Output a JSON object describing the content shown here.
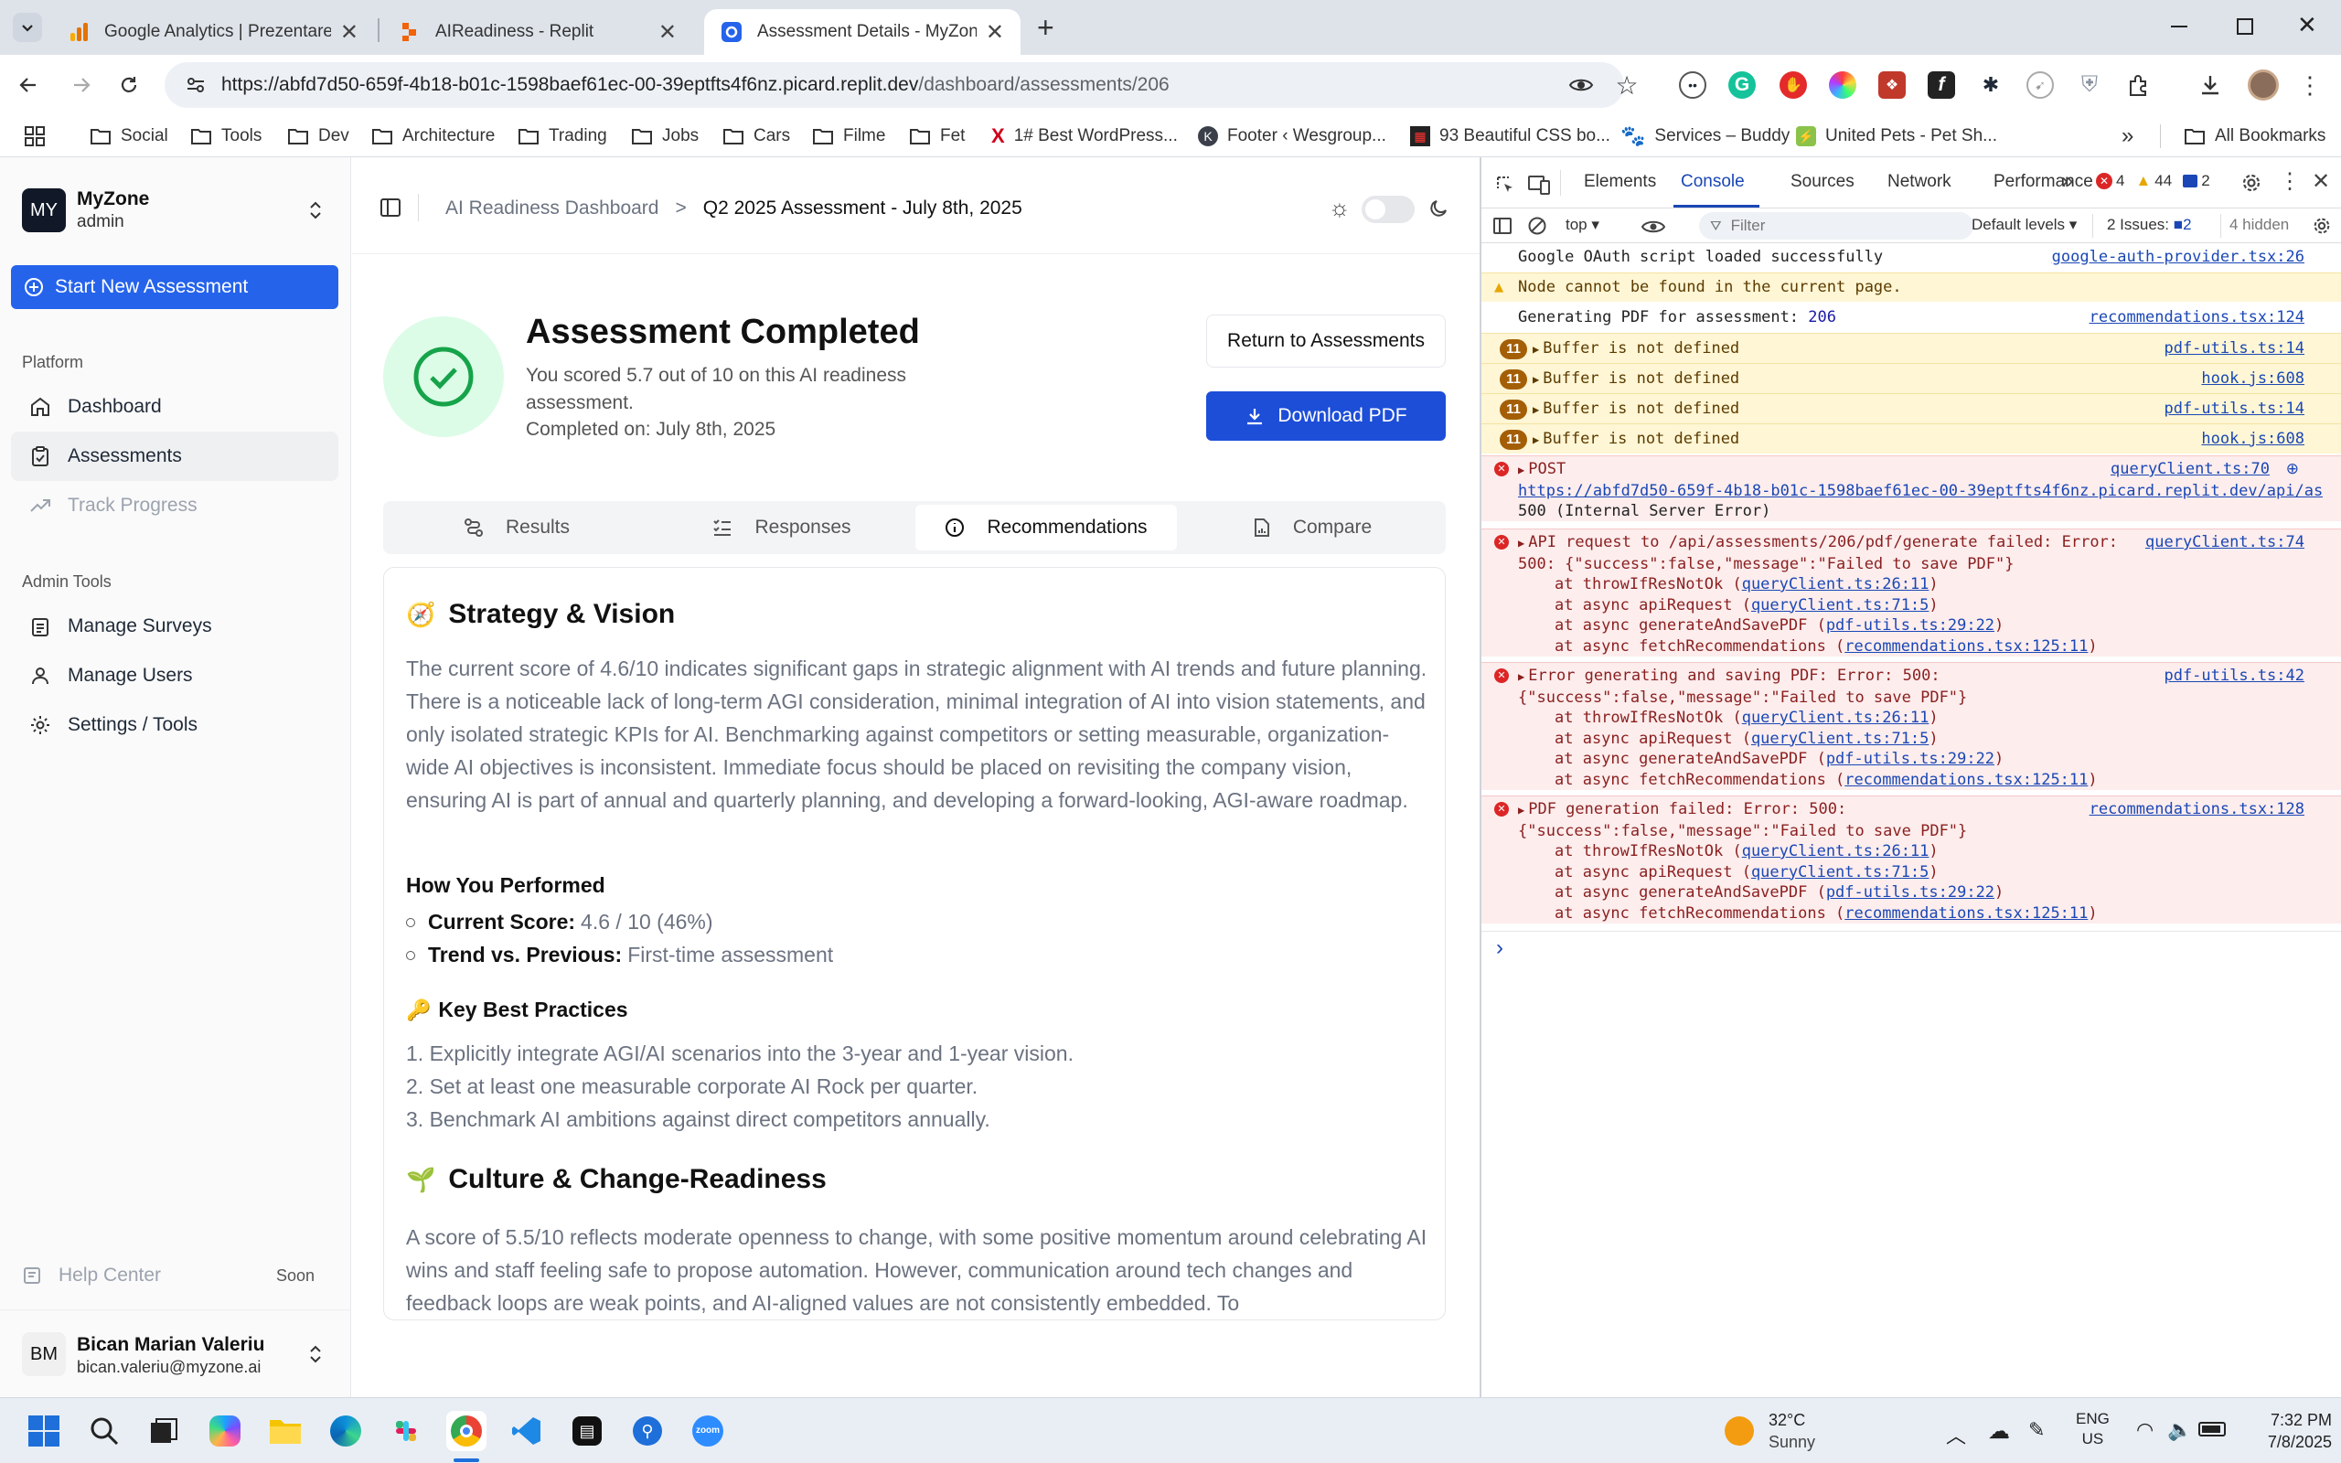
{
  "browser": {
    "tabs": [
      {
        "title": "Google Analytics | Prezentare g"
      },
      {
        "title": "AIReadiness - Replit"
      },
      {
        "title": "Assessment Details - MyZone A"
      }
    ],
    "url_host": "https://abfd7d50-659f-4b18-b01c-1598baef61ec-00-39eptfts4f6nz.picard.replit.dev",
    "url_path": "/dashboard/assessments/206",
    "bookmarks": [
      "Social",
      "Tools",
      "Dev",
      "Architecture",
      "Trading",
      "Jobs",
      "Cars",
      "Filme",
      "Fet",
      "1# Best WordPress...",
      "Footer ‹ Wesgroup...",
      "93 Beautiful CSS bo...",
      "Services – Buddy",
      "United Pets - Pet Sh..."
    ],
    "all_bookmarks": "All Bookmarks",
    "more_bookmarks": "»"
  },
  "sidebar": {
    "logo_initials": "MY",
    "org_name": "MyZone",
    "org_role": "admin",
    "new_assessment": "Start New Assessment",
    "platform_heading": "Platform",
    "platform_items": [
      "Dashboard",
      "Assessments",
      "Track Progress"
    ],
    "admin_heading": "Admin Tools",
    "admin_items": [
      "Manage Surveys",
      "Manage Users",
      "Settings / Tools"
    ],
    "help_center": "Help Center",
    "help_badge": "Soon",
    "user_initials": "BM",
    "user_name": "Bican Marian Valeriu",
    "user_email": "bican.valeriu@myzone.ai"
  },
  "main": {
    "breadcrumb_root": "AI Readiness Dashboard",
    "breadcrumb_sep": ">",
    "breadcrumb_current": "Q2 2025 Assessment - July 8th, 2025",
    "status_title": "Assessment Completed",
    "score_text": "You scored 5.7 out of 10 on this AI readiness assessment.",
    "completed_text": "Completed on: July 8th, 2025",
    "return_button": "Return to Assessments",
    "download_button": "Download PDF",
    "tabs": [
      "Results",
      "Responses",
      "Recommendations",
      "Compare"
    ],
    "section1": {
      "emoji": "🧭",
      "title": "Strategy & Vision",
      "body": "The current score of 4.6/10 indicates significant gaps in strategic alignment with AI trends and future planning. There is a noticeable lack of long-term AGI consideration, minimal integration of AI into vision statements, and only isolated strategic KPIs for AI. Benchmarking against competitors or setting measurable, organization-wide AI objectives is inconsistent. Immediate focus should be placed on revisiting the company vision, ensuring AI is part of annual and quarterly planning, and developing a forward-looking, AGI-aware roadmap.",
      "perf_heading": "How You Performed",
      "current_score_label": "Current Score:",
      "current_score_value": "4.6 / 10 (46%)",
      "trend_label": "Trend vs. Previous:",
      "trend_value": "First-time assessment",
      "practices_emoji": "🔑",
      "practices_heading": "Key Best Practices",
      "practices": [
        "1. Explicitly integrate AGI/AI scenarios into the 3-year and 1-year vision.",
        "2. Set at least one measurable corporate AI Rock per quarter.",
        "3. Benchmark AI ambitions against direct competitors annually."
      ]
    },
    "section2": {
      "emoji": "🌱",
      "title": "Culture & Change-Readiness",
      "body": "A score of 5.5/10 reflects moderate openness to change, with some positive momentum around celebrating AI wins and staff feeling safe to propose automation. However, communication around tech changes and feedback loops are weak points, and AI-aligned values are not consistently embedded. To"
    }
  },
  "devtools": {
    "tabs": [
      "Elements",
      "Console",
      "Sources",
      "Network",
      "Performance"
    ],
    "error_count": "4",
    "warning_count": "44",
    "info_count": "2",
    "context": "top",
    "filter_placeholder": "Filter",
    "levels": "Default levels",
    "issues_label": "2 Issues:",
    "issues_count": "2",
    "hidden": "4 hidden",
    "rows": [
      {
        "text": "Google OAuth script loaded successfully",
        "src": "google-auth-provider.tsx:26"
      },
      {
        "text": "Node cannot be found in the current page.",
        "src": ""
      },
      {
        "text": "Generating PDF for assessment: ",
        "value": "206",
        "src": "recommendations.tsx:124"
      },
      {
        "count": "11",
        "text": "Buffer is not defined",
        "src": "pdf-utils.ts:14"
      },
      {
        "count": "11",
        "text": "Buffer is not defined",
        "src": "hook.js:608"
      },
      {
        "count": "11",
        "text": "Buffer is not defined",
        "src": "pdf-utils.ts:14"
      },
      {
        "count": "11",
        "text": "Buffer is not defined",
        "src": "hook.js:608"
      }
    ],
    "post": {
      "method": "POST",
      "src": "queryClient.ts:70",
      "url": "https://abfd7d50-659f-4b18-b01c-1598baef61ec-00-39eptfts4f6nz.picard.replit.dev/api/as…",
      "status": "500 (Internal Server Error)"
    },
    "errors": [
      {
        "line1": "API request to /api/assessments/206/pdf/generate failed: Error:",
        "line2": "500: {\"success\":false,\"message\":\"Failed to save PDF\"}",
        "src": "queryClient.ts:74"
      },
      {
        "line1": "Error generating and saving PDF: Error: 500:",
        "line2": "{\"success\":false,\"message\":\"Failed to save PDF\"}",
        "src": "pdf-utils.ts:42"
      },
      {
        "line1": "PDF generation failed: Error: 500:",
        "line2": "{\"success\":false,\"message\":\"Failed to save PDF\"}",
        "src": "recommendations.tsx:128"
      }
    ],
    "stack": [
      {
        "prefix": "at throwIfResNotOk (",
        "link": "queryClient.ts:26:11"
      },
      {
        "prefix": "at async apiRequest (",
        "link": "queryClient.ts:71:5"
      },
      {
        "prefix": "at async generateAndSavePDF (",
        "link": "pdf-utils.ts:29:22"
      },
      {
        "prefix": "at async fetchRecommendations (",
        "link": "recommendations.tsx:125:11"
      }
    ],
    "prompt": "›"
  },
  "taskbar": {
    "temperature": "32°C",
    "weather": "Sunny",
    "lang1": "ENG",
    "lang2": "US",
    "time": "7:32 PM",
    "date": "7/8/2025"
  }
}
